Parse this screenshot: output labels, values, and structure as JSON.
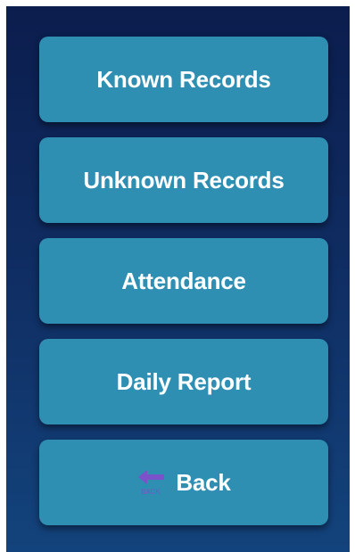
{
  "menu": {
    "items": [
      {
        "label": "Known Records"
      },
      {
        "label": "Unknown Records"
      },
      {
        "label": "Attendance"
      },
      {
        "label": "Daily Report"
      }
    ],
    "back": {
      "label": "Back",
      "icon": "back-arrow-icon",
      "icon_caption": "BACK"
    }
  },
  "colors": {
    "background_top": "#0b1d4d",
    "background_bottom": "#13437c",
    "button": "#2e8fb3",
    "button_text": "#ffffff",
    "back_icon": "#7b52c9"
  }
}
